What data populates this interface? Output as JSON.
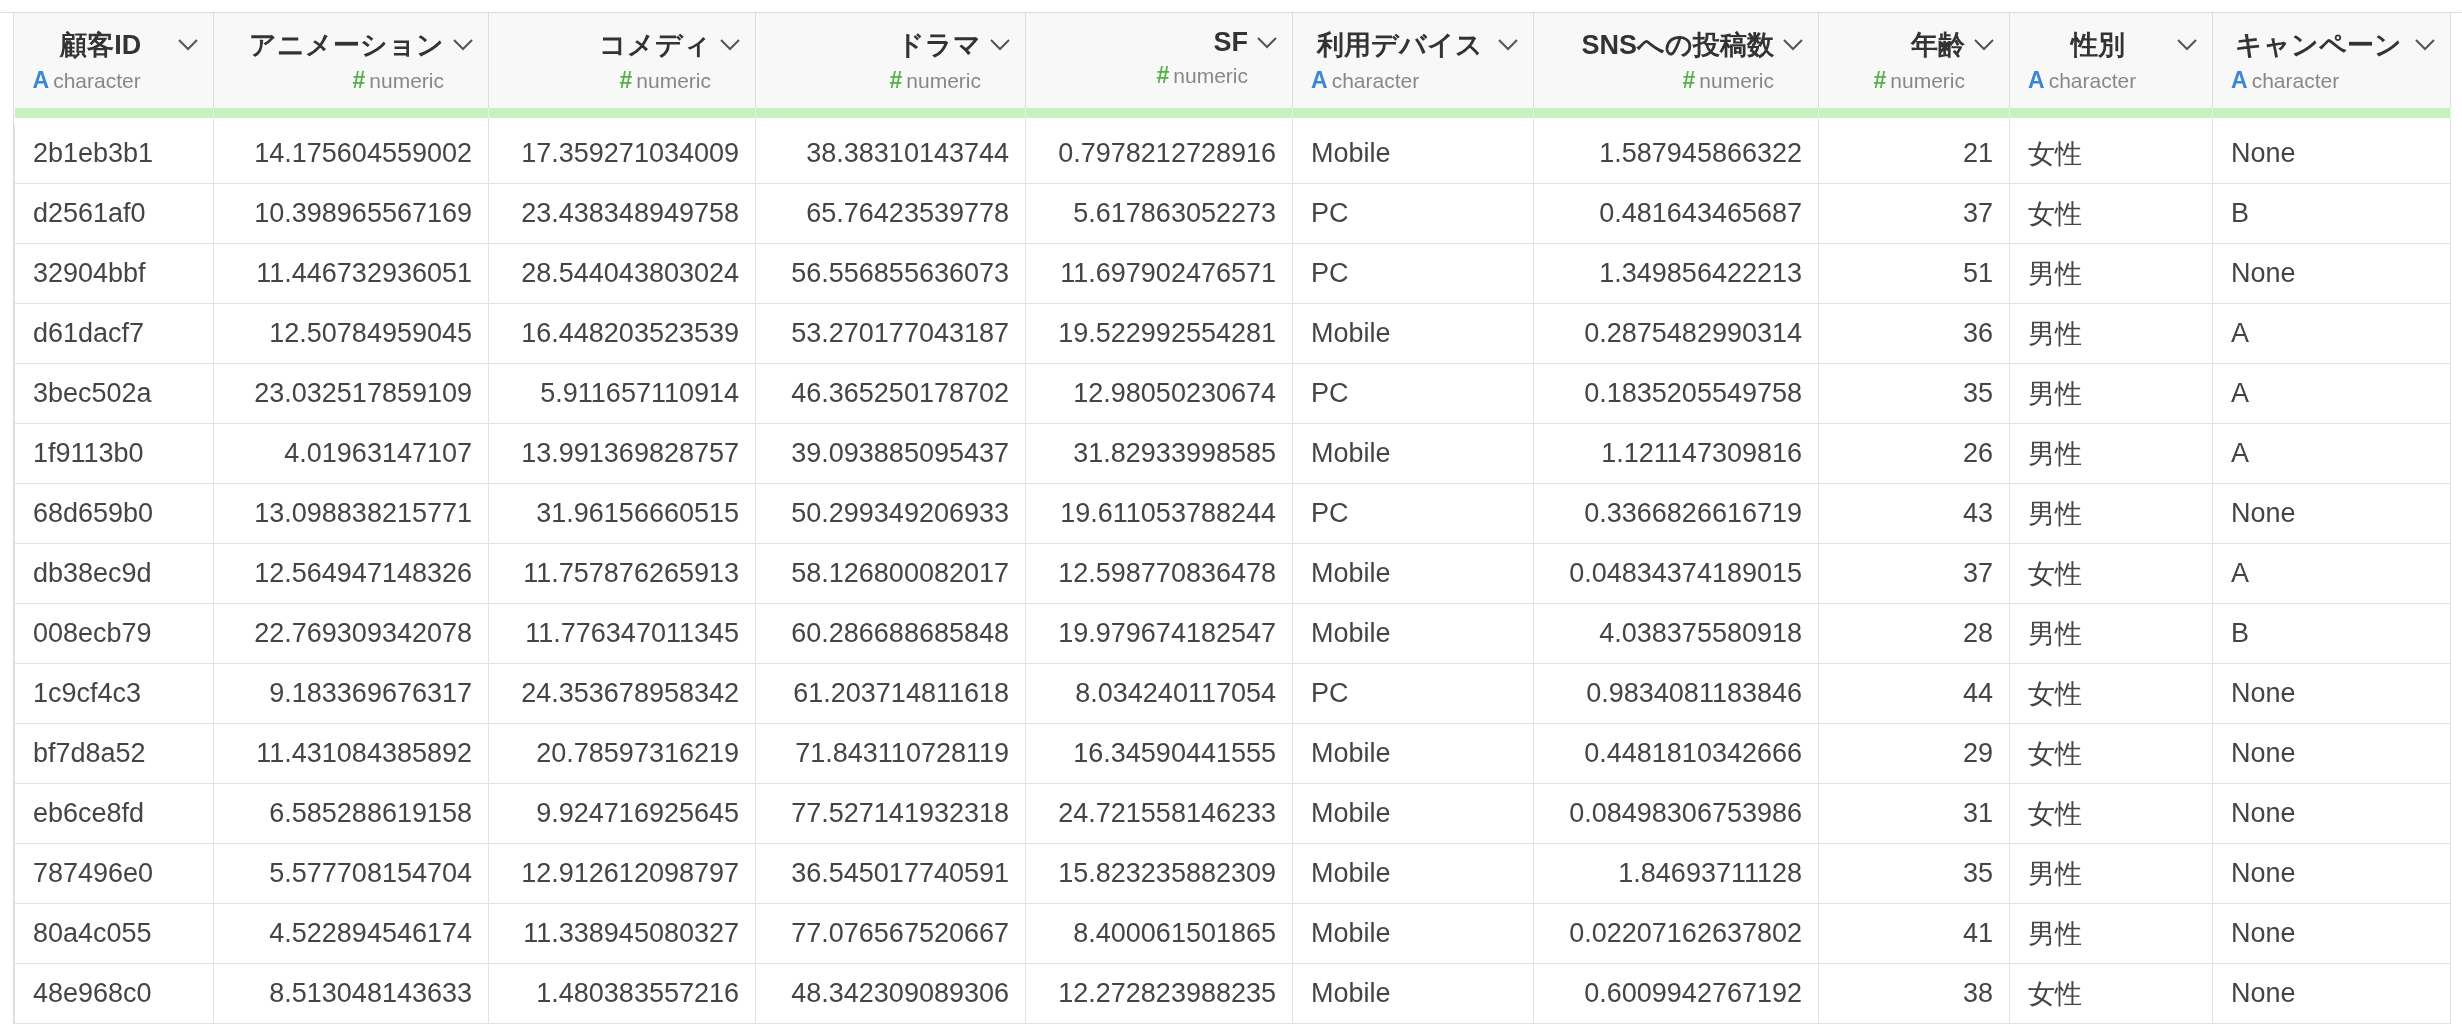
{
  "table": {
    "columns": [
      {
        "name": "顧客ID",
        "kind": "character",
        "type_mark": "A",
        "type": "character"
      },
      {
        "name": "アニメーション",
        "kind": "numeric",
        "type_mark": "#",
        "type": "numeric"
      },
      {
        "name": "コメディ",
        "kind": "numeric",
        "type_mark": "#",
        "type": "numeric"
      },
      {
        "name": "ドラマ",
        "kind": "numeric",
        "type_mark": "#",
        "type": "numeric"
      },
      {
        "name": "SF",
        "kind": "numeric",
        "type_mark": "#",
        "type": "numeric"
      },
      {
        "name": "利用デバイス",
        "kind": "character",
        "type_mark": "A",
        "type": "character"
      },
      {
        "name": "SNSへの投稿数",
        "kind": "numeric",
        "type_mark": "#",
        "type": "numeric"
      },
      {
        "name": "年齢",
        "kind": "numeric",
        "type_mark": "#",
        "type": "numeric"
      },
      {
        "name": "性別",
        "kind": "character",
        "type_mark": "A",
        "type": "character"
      },
      {
        "name": "キャンペーン",
        "kind": "character",
        "type_mark": "A",
        "type": "character"
      }
    ],
    "rows": [
      [
        "2b1eb3b1",
        "14.175604559002",
        "17.359271034009",
        "38.38310143744",
        "0.7978212728916",
        "Mobile",
        "1.587945866322",
        "21",
        "女性",
        "None"
      ],
      [
        "d2561af0",
        "10.398965567169",
        "23.438348949758",
        "65.76423539778",
        "5.617863052273",
        "PC",
        "0.481643465687",
        "37",
        "女性",
        "B"
      ],
      [
        "32904bbf",
        "11.446732936051",
        "28.544043803024",
        "56.556855636073",
        "11.697902476571",
        "PC",
        "1.349856422213",
        "51",
        "男性",
        "None"
      ],
      [
        "d61dacf7",
        "12.50784959045",
        "16.448203523539",
        "53.270177043187",
        "19.522992554281",
        "Mobile",
        "0.2875482990314",
        "36",
        "男性",
        "A"
      ],
      [
        "3bec502a",
        "23.032517859109",
        "5.911657110914",
        "46.365250178702",
        "12.98050230674",
        "PC",
        "0.1835205549758",
        "35",
        "男性",
        "A"
      ],
      [
        "1f9113b0",
        "4.01963147107",
        "13.991369828757",
        "39.093885095437",
        "31.82933998585",
        "Mobile",
        "1.121147309816",
        "26",
        "男性",
        "A"
      ],
      [
        "68d659b0",
        "13.098838215771",
        "31.96156660515",
        "50.299349206933",
        "19.611053788244",
        "PC",
        "0.3366826616719",
        "43",
        "男性",
        "None"
      ],
      [
        "db38ec9d",
        "12.564947148326",
        "11.757876265913",
        "58.126800082017",
        "12.598770836478",
        "Mobile",
        "0.04834374189015",
        "37",
        "女性",
        "A"
      ],
      [
        "008ecb79",
        "22.769309342078",
        "11.776347011345",
        "60.286688685848",
        "19.979674182547",
        "Mobile",
        "4.038375580918",
        "28",
        "男性",
        "B"
      ],
      [
        "1c9cf4c3",
        "9.183369676317",
        "24.353678958342",
        "61.203714811618",
        "8.034240117054",
        "PC",
        "0.9834081183846",
        "44",
        "女性",
        "None"
      ],
      [
        "bf7d8a52",
        "11.431084385892",
        "20.78597316219",
        "71.843110728119",
        "16.34590441555",
        "Mobile",
        "0.4481810342666",
        "29",
        "女性",
        "None"
      ],
      [
        "eb6ce8fd",
        "6.585288619158",
        "9.924716925645",
        "77.527141932318",
        "24.721558146233",
        "Mobile",
        "0.08498306753986",
        "31",
        "女性",
        "None"
      ],
      [
        "787496e0",
        "5.577708154704",
        "12.912612098797",
        "36.545017740591",
        "15.823235882309",
        "Mobile",
        "1.84693711128",
        "35",
        "男性",
        "None"
      ],
      [
        "80a4c055",
        "4.522894546174",
        "11.338945080327",
        "77.076567520667",
        "8.400061501865",
        "Mobile",
        "0.02207162637802",
        "41",
        "男性",
        "None"
      ],
      [
        "48e968c0",
        "8.513048143633",
        "1.480383557216",
        "48.342309089306",
        "12.272823988235",
        "Mobile",
        "0.6009942767192",
        "38",
        "女性",
        "None"
      ]
    ]
  }
}
